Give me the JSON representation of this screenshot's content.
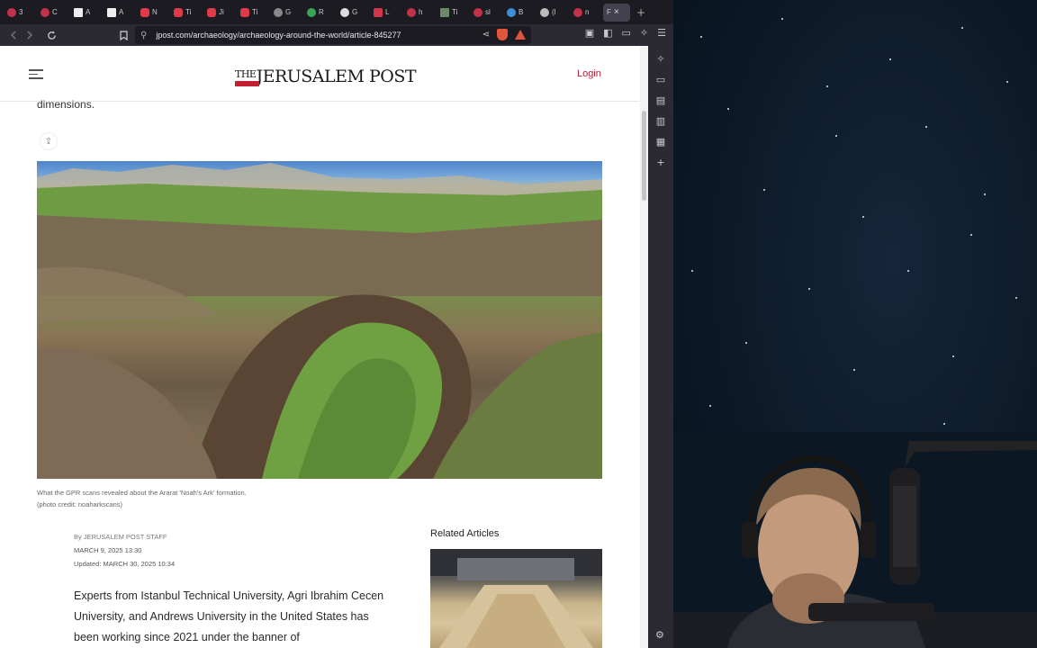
{
  "browser": {
    "tabs": [
      "3",
      "C",
      "A",
      "A",
      "N",
      "Ti",
      "Ji",
      "Ti",
      "G",
      "R",
      "G",
      "L",
      "h",
      "Ti",
      "sl",
      "B",
      "(l",
      "n",
      "F"
    ],
    "active_tab_close": "×",
    "new_tab": "+",
    "url": "jpost.com/archaeology/archaeology-around-the-world/article-845277",
    "icons": {
      "back": "back-arrow-icon",
      "forward": "forward-arrow-icon",
      "reload": "reload-icon",
      "bookmark": "bookmark-icon",
      "share": "share-icon",
      "shield": "brave-shield-icon",
      "rewards": "brave-rewards-icon",
      "menu": "hamburger-menu-icon"
    }
  },
  "site": {
    "logo_the": "THE",
    "logo_name": "JERUSALEM POST",
    "login_label": "Login",
    "accent_color": "#b3203a"
  },
  "article": {
    "tail_text": "dimensions.",
    "caption_line1": "What the GPR scans revealed about the Ararat 'Noah's Ark' formation.",
    "caption_line2": "(photo credit: noaharkscans)",
    "byline": "By JERUSALEM POST STAFF",
    "date": "MARCH 9, 2025 13:30",
    "updated": "Updated: MARCH 30, 2025 10:34",
    "body": "Experts from Istanbul Technical University, Agri Ibrahim Cecen University, and Andrews University in the United States has been working since 2021 under the banner of"
  },
  "related": {
    "title": "Related Articles"
  }
}
